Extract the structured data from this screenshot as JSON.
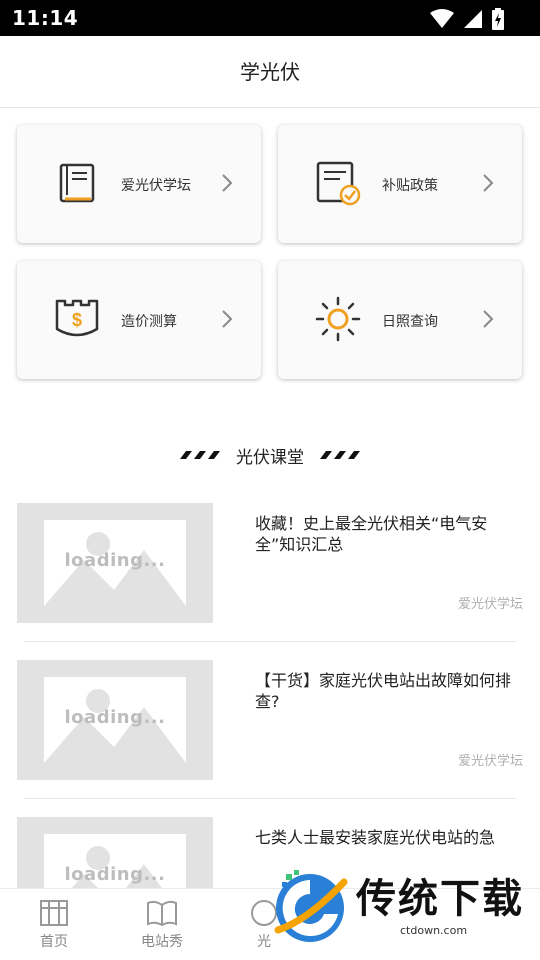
{
  "status_bar": {
    "time": "11:14"
  },
  "header": {
    "title": "学光伏"
  },
  "menu_cards": [
    {
      "label": "爱光伏学坛",
      "icon": "book-icon"
    },
    {
      "label": "补贴政策",
      "icon": "document-check-icon"
    },
    {
      "label": "造价测算",
      "icon": "money-shield-icon"
    },
    {
      "label": "日照查询",
      "icon": "sun-icon"
    }
  ],
  "section": {
    "title": "光伏课堂"
  },
  "articles": [
    {
      "thumb_text": "loading...",
      "title": "收藏！史上最全光伏相关“电气安全”知识汇总",
      "source": "爱光伏学坛"
    },
    {
      "thumb_text": "loading...",
      "title": "【干货】家庭光伏电站出故障如何排查?",
      "source": "爱光伏学坛"
    },
    {
      "thumb_text": "loading...",
      "title": "七类人士最安装家庭光伏电站的急",
      "source": ""
    }
  ],
  "bottom_nav": [
    {
      "label": "首页",
      "icon": "home-icon"
    },
    {
      "label": "电站秀",
      "icon": "open-book-icon"
    },
    {
      "label": "光",
      "icon": "globe-icon"
    }
  ],
  "watermark": {
    "text": "传统下载",
    "url": "ctdown.com"
  },
  "colors": {
    "accent": "#f0a020",
    "icon_dark": "#333333"
  }
}
